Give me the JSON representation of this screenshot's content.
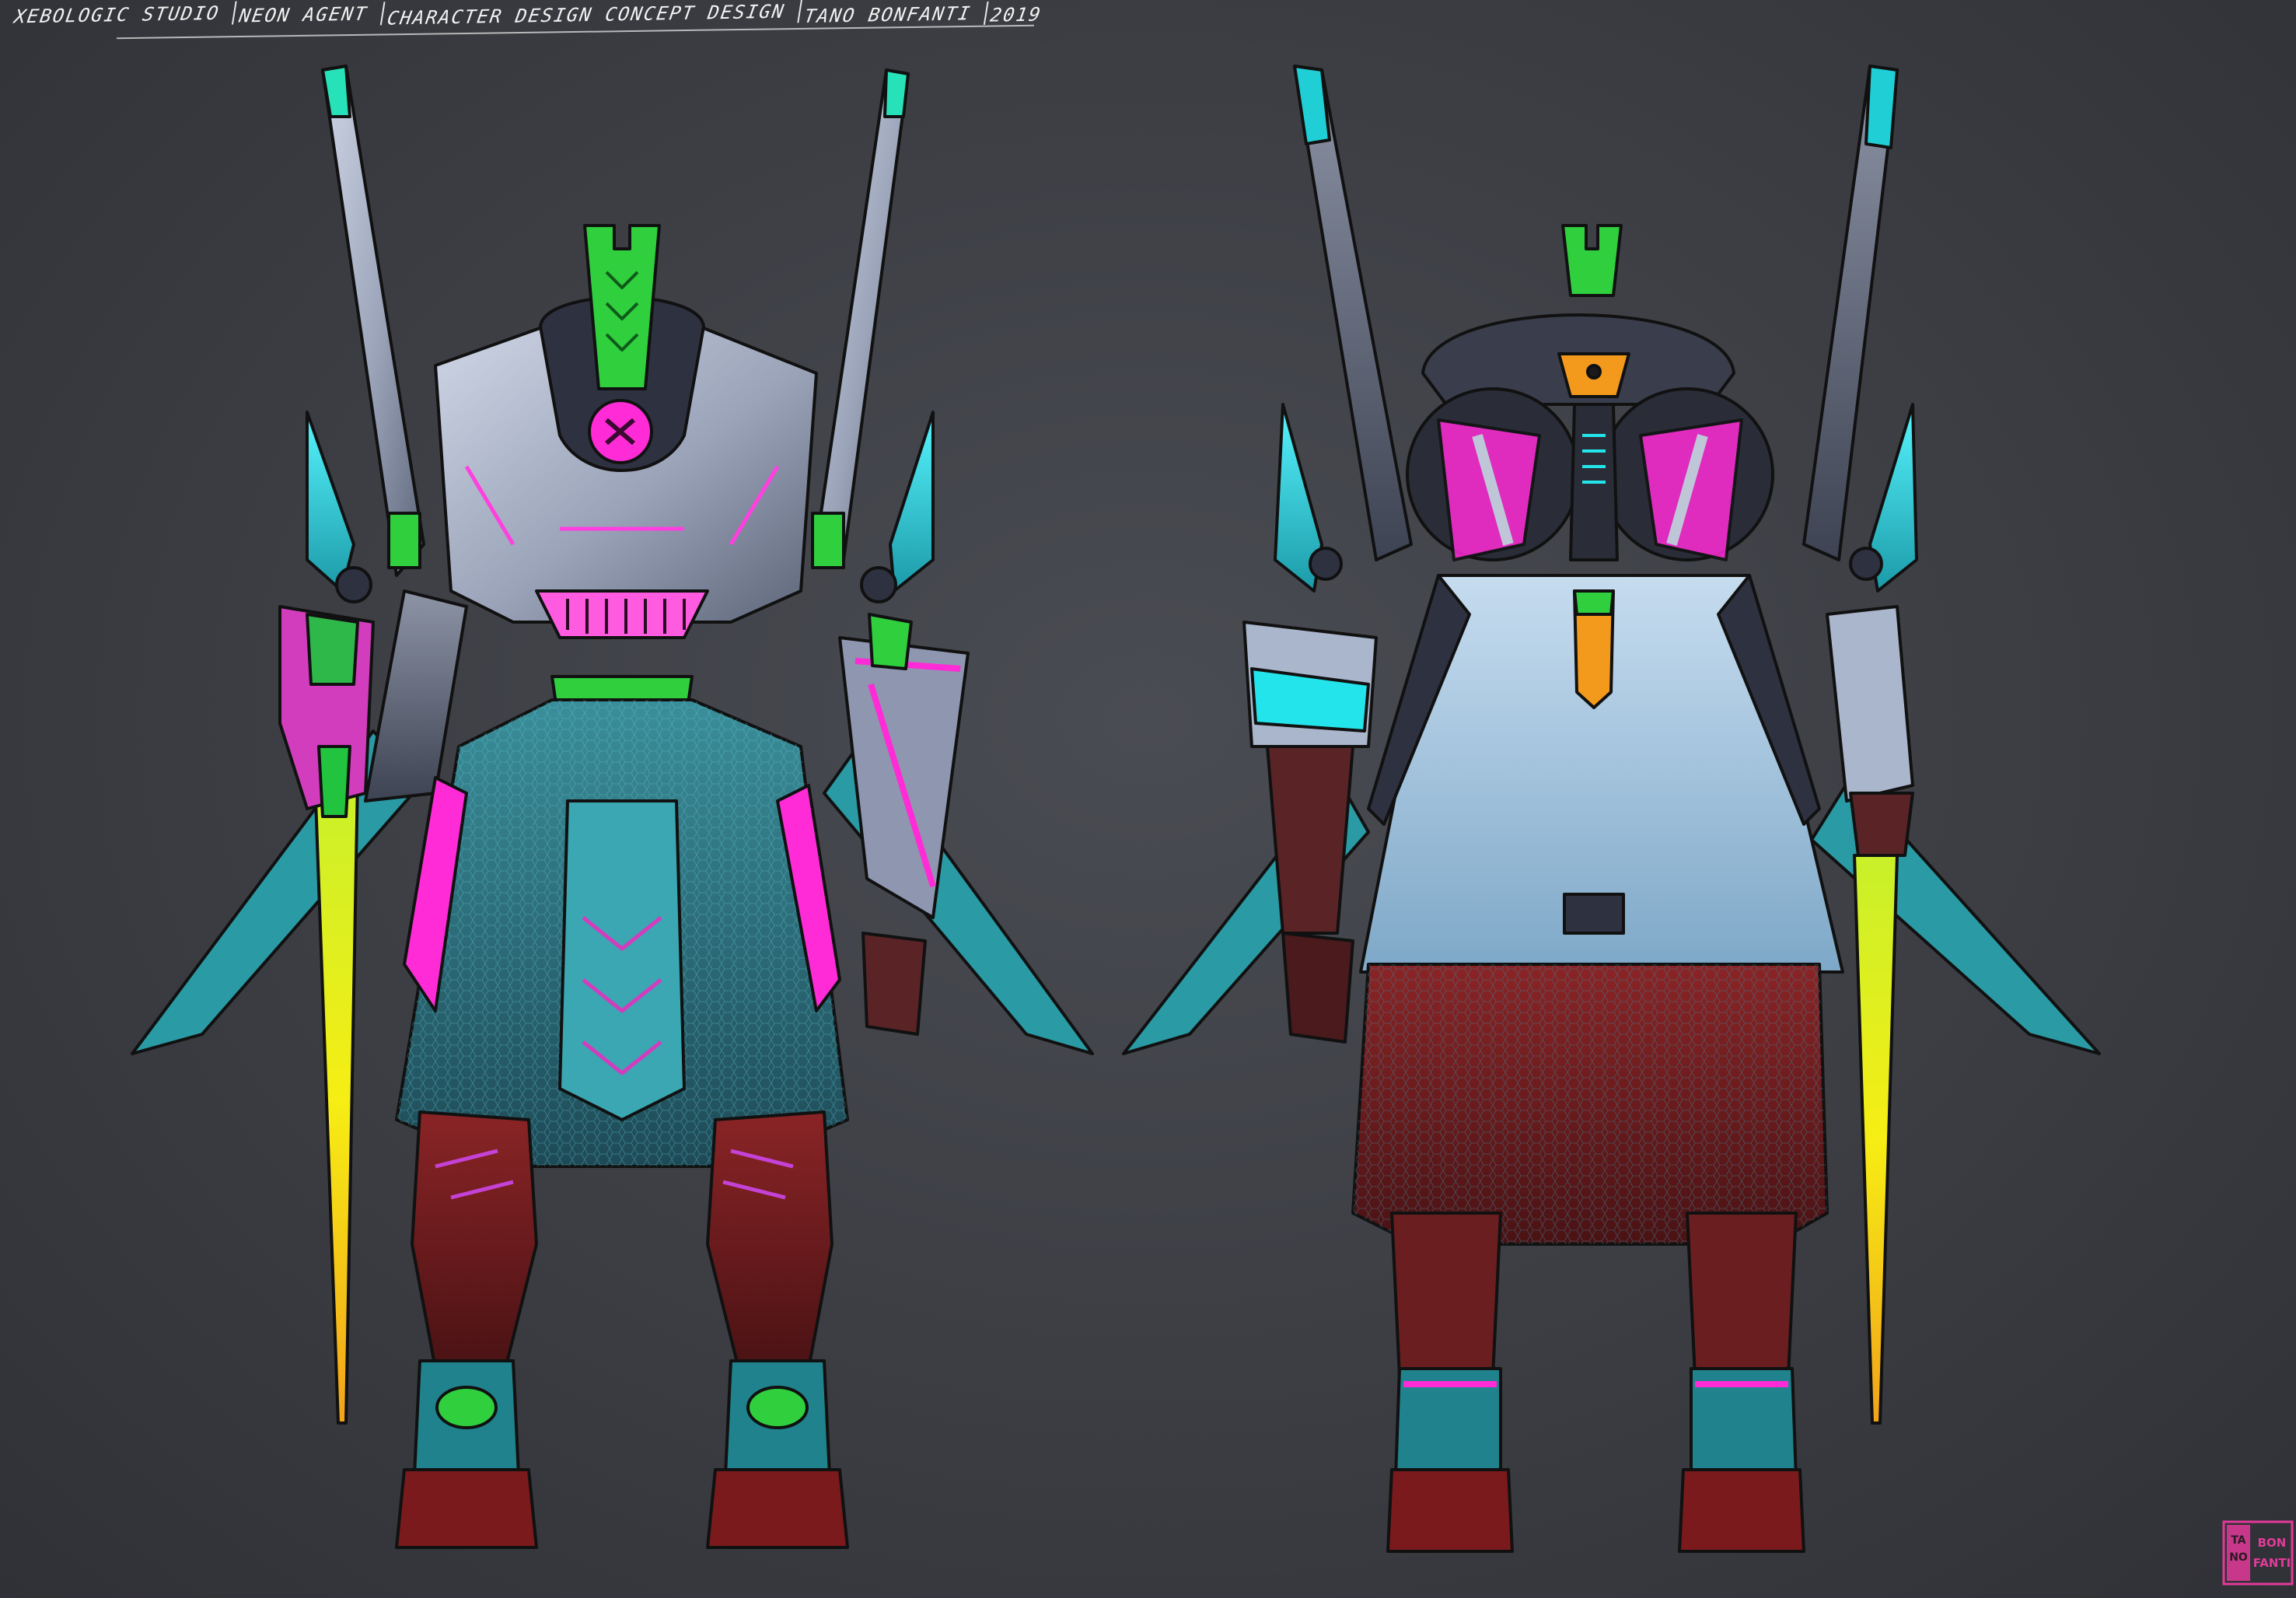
{
  "header": {
    "segments": [
      "XEBOLOGIC STUDIO",
      "NEON AGENT",
      "CHARACTER DESIGN CONCEPT DESIGN",
      "TANO BONFANTI",
      "2019"
    ]
  },
  "views": {
    "front": {
      "icon": "robot-front-view-figure"
    },
    "back": {
      "icon": "robot-back-view-figure"
    }
  },
  "signature": {
    "icon": "artist-signature-stamp",
    "text": "TANO BON FANTI"
  },
  "colors": {
    "background": "#3e4046",
    "neon_pink": "#ff2bd6",
    "neon_cyan": "#22e4ea",
    "neon_green": "#22d64a",
    "neon_yellow": "#f4ea12",
    "orange": "#f39a1c",
    "armor_silver": "#b4bccf",
    "dark_red": "#7a1a1c",
    "teal_cloth": "#2f8f9a"
  }
}
